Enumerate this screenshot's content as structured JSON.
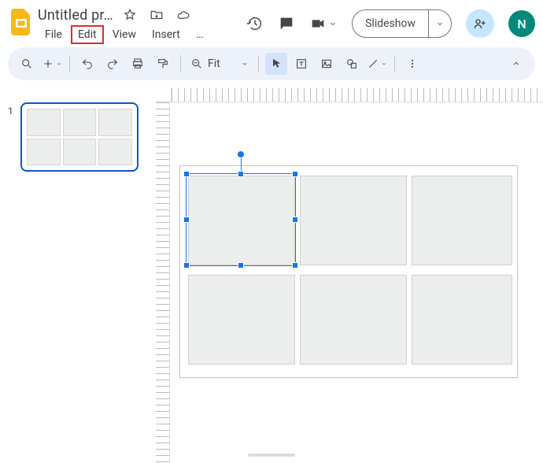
{
  "doc": {
    "title": "Untitled pr…"
  },
  "menus": {
    "file": "File",
    "edit": "Edit",
    "view": "View",
    "insert": "Insert",
    "more": "…"
  },
  "header": {
    "slideshow": "Slideshow",
    "avatar_initial": "N"
  },
  "toolbar": {
    "zoom_label": "Fit"
  },
  "filmstrip": {
    "slide_number": "1"
  },
  "icons": {
    "star": "star-icon",
    "move": "move-to-folder-icon",
    "cloud": "cloud-saved-icon",
    "history": "history-icon",
    "comment": "comment-icon",
    "camera": "video-call-icon",
    "share": "share-icon",
    "search": "search-icon",
    "new": "new-slide-icon",
    "undo": "undo-icon",
    "redo": "redo-icon",
    "print": "print-icon",
    "paint": "paint-format-icon",
    "zoom": "zoom-icon",
    "cursor": "select-icon",
    "textbox": "text-box-icon",
    "image": "image-icon",
    "shape": "shape-icon",
    "line": "line-icon",
    "overflow": "more-icon",
    "collapse": "collapse-icon"
  }
}
